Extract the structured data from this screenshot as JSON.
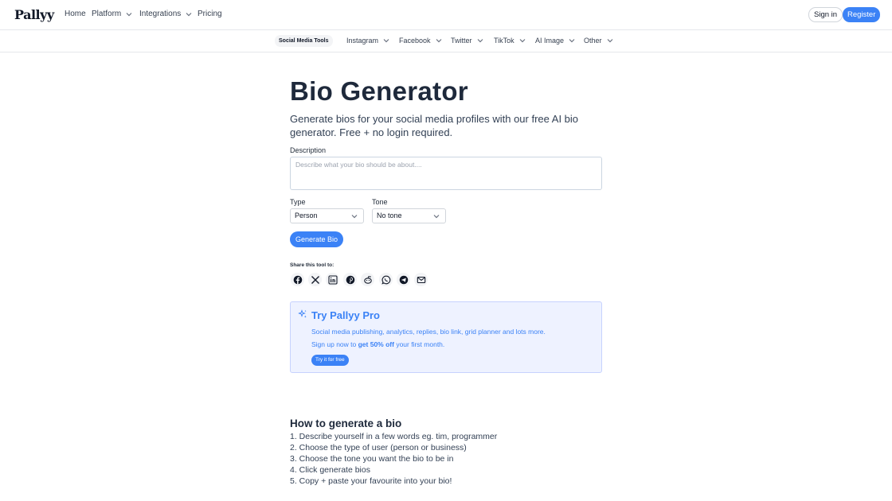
{
  "header": {
    "logo": "Pallyy",
    "nav": [
      {
        "label": "Home",
        "dropdown": false
      },
      {
        "label": "Platform",
        "dropdown": true
      },
      {
        "label": "Integrations",
        "dropdown": true
      },
      {
        "label": "Pricing",
        "dropdown": false
      }
    ],
    "sign_in": "Sign in",
    "register": "Register"
  },
  "subnav": {
    "active": "Social Media Tools",
    "items": [
      "Instagram",
      "Facebook",
      "Twitter",
      "TikTok",
      "AI Image",
      "Other"
    ]
  },
  "main": {
    "title": "Bio Generator",
    "subtitle": "Generate bios for your social media profiles with our free AI bio generator. Free + no login required.",
    "description_label": "Description",
    "description_placeholder": "Describe what your bio should be about....",
    "type_label": "Type",
    "type_value": "Person",
    "tone_label": "Tone",
    "tone_value": "No tone",
    "generate_button": "Generate Bio",
    "share_label": "Share this tool to:",
    "share_icons": [
      "facebook-icon",
      "x-icon",
      "linkedin-icon",
      "pinterest-icon",
      "reddit-icon",
      "whatsapp-icon",
      "telegram-icon",
      "email-icon"
    ]
  },
  "promo": {
    "title": "Try Pallyy Pro",
    "line1": "Social media publishing, analytics, replies, bio link, grid planner and lots more.",
    "line2_prefix": "Sign up now to",
    "line2_bold": "get 50% off",
    "line2_suffix": "your first month.",
    "button": "Try it for free"
  },
  "howto": {
    "title": "How to generate a bio",
    "steps": [
      "1. Describe yourself in a few words eg. tim, programmer",
      "2. Choose the type of user (person or business)",
      "3. Choose the tone you want the bio to be in",
      "4. Click generate bios",
      "5. Copy + paste your favourite into your bio!"
    ]
  },
  "colors": {
    "accent": "#3b82f6",
    "promo_bg": "#eef2ff",
    "title": "#1e293b"
  }
}
